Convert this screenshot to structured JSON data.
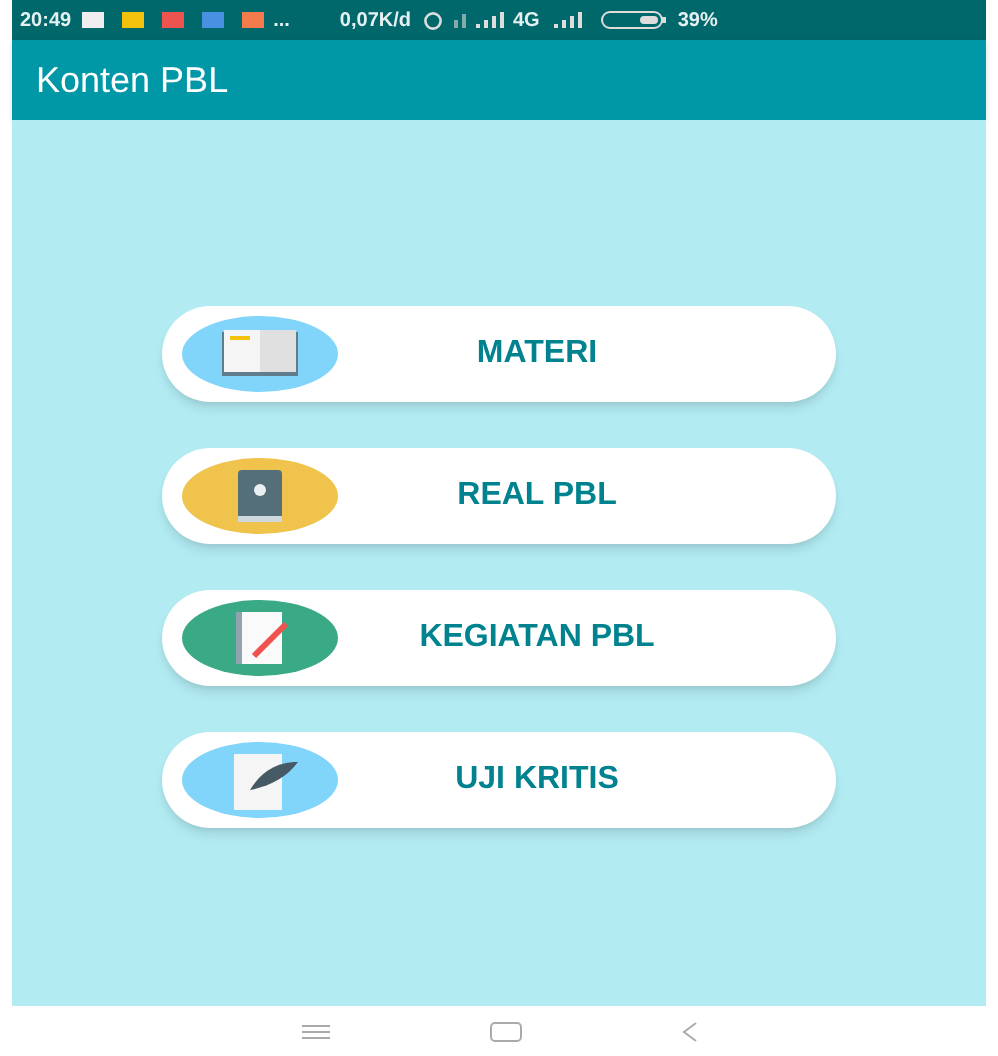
{
  "status_bar": {
    "time": "20:49",
    "more": "...",
    "speed": "0,07K/d",
    "network": "4G",
    "battery": "39%"
  },
  "app_bar": {
    "title": "Konten PBL"
  },
  "menu": [
    {
      "label": "MATERI",
      "kind": "book"
    },
    {
      "label": "REAL PBL",
      "kind": "tablet"
    },
    {
      "label": "KEGIATAN PBL",
      "kind": "notepad"
    },
    {
      "label": "UJI KRITIS",
      "kind": "feather"
    }
  ]
}
